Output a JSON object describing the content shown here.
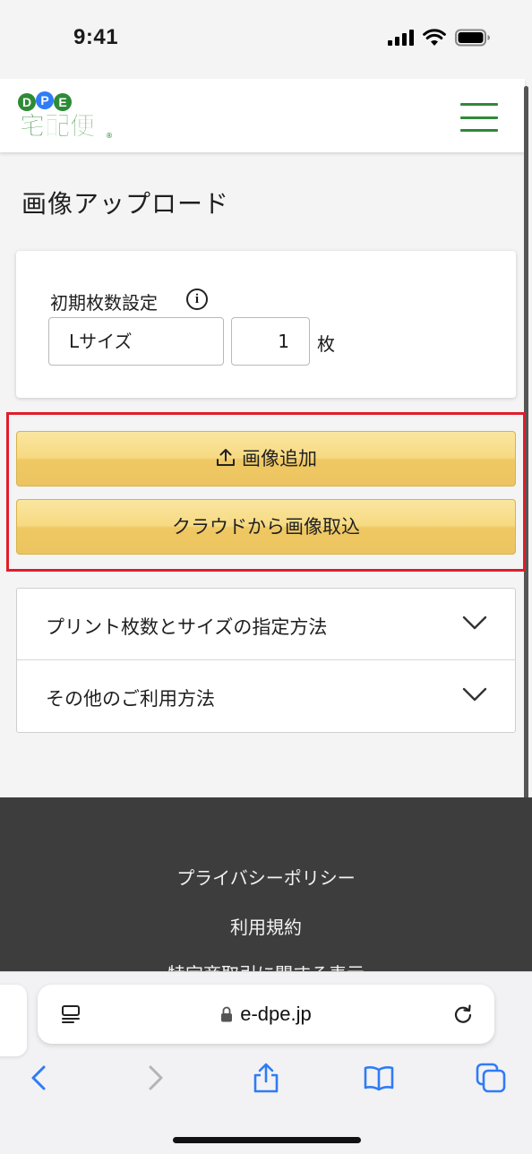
{
  "status_bar": {
    "time": "9:41"
  },
  "header": {
    "logo_top": "DPE",
    "logo_main": "宅配便",
    "logo_reg": "®"
  },
  "page": {
    "title": "画像アップロード"
  },
  "settings": {
    "label": "初期枚数設定",
    "info_glyph": "i",
    "size_value": "Lサイズ",
    "quantity_value": "1",
    "unit": "枚"
  },
  "actions": {
    "add_image_label": "画像追加",
    "cloud_import_label": "クラウドから画像取込"
  },
  "accordion": {
    "items": [
      {
        "label": "プリント枚数とサイズの指定方法"
      },
      {
        "label": "その他のご利用方法"
      }
    ]
  },
  "footer": {
    "links": [
      "プライバシーポリシー",
      "利用規約",
      "特定商取引に関する表示"
    ]
  },
  "browser": {
    "url": "e-dpe.jp",
    "icons": [
      "reader-icon",
      "lock-icon",
      "reload-icon",
      "back-icon",
      "forward-icon",
      "share-icon",
      "bookmarks-icon",
      "tabs-icon"
    ]
  },
  "colors": {
    "brand_green": "#2e8a36",
    "highlight_red": "#e01d2b",
    "button_gold": "#f6d982",
    "ios_blue": "#2f7cf6"
  }
}
